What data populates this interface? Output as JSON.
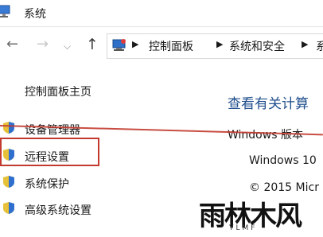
{
  "window": {
    "title": "系统"
  },
  "navigation": {
    "back_icon": "arrow-left-icon",
    "forward_icon": "arrow-right-icon",
    "recent_icon": "chevron-down-icon",
    "up_icon": "arrow-up-icon",
    "breadcrumb": [
      "控制面板",
      "系统和安全",
      "系"
    ]
  },
  "sidebar": {
    "home_label": "控制面板主页",
    "items": [
      {
        "label": "设备管理器",
        "icon": "shield-icon"
      },
      {
        "label": "远程设置",
        "icon": "shield-icon"
      },
      {
        "label": "系统保护",
        "icon": "shield-icon"
      },
      {
        "label": "高级系统设置",
        "icon": "shield-icon"
      }
    ]
  },
  "main": {
    "title": "查看有关计算",
    "edition_heading": "Windows 版本",
    "edition_name": "Windows 10",
    "copyright": "© 2015 Micr"
  },
  "annotation": {
    "color": "#c23a2e",
    "highlighted_item": "远程设置"
  },
  "watermark": {
    "text": "雨林木风",
    "subtext": "YLMF"
  }
}
